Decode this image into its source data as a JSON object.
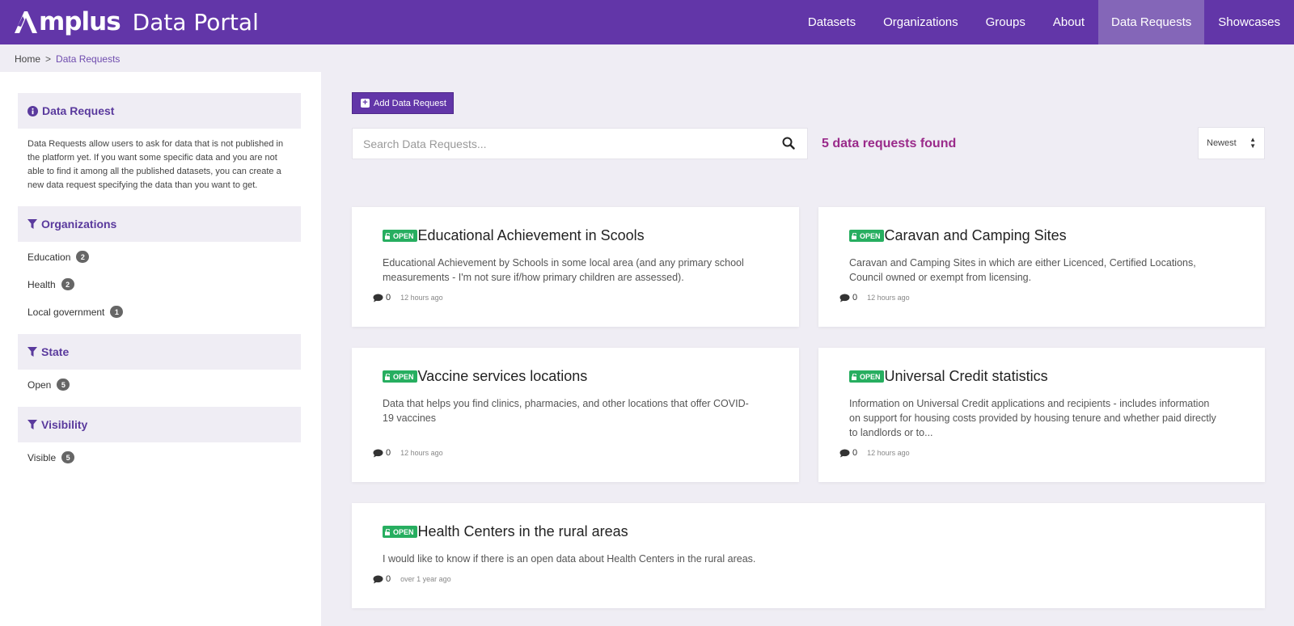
{
  "header": {
    "logo_text": "mplus",
    "portal_label": "Data Portal",
    "nav": [
      {
        "label": "Datasets",
        "active": false
      },
      {
        "label": "Organizations",
        "active": false
      },
      {
        "label": "Groups",
        "active": false
      },
      {
        "label": "About",
        "active": false
      },
      {
        "label": "Data Requests",
        "active": true
      },
      {
        "label": "Showcases",
        "active": false
      }
    ]
  },
  "breadcrumb": {
    "home": "Home",
    "separator": ">",
    "current": "Data Requests"
  },
  "sidebar": {
    "info": {
      "title": "Data Request",
      "description": "Data Requests allow users to ask for data that is not published in the platform yet. If you want some specific data and you are not able to find it among all the published datasets, you can create a new data request specifying the data than you want to get."
    },
    "organizations": {
      "title": "Organizations",
      "items": [
        {
          "label": "Education",
          "count": "2"
        },
        {
          "label": "Health",
          "count": "2"
        },
        {
          "label": "Local government",
          "count": "1"
        }
      ]
    },
    "state": {
      "title": "State",
      "items": [
        {
          "label": "Open",
          "count": "5"
        }
      ]
    },
    "visibility": {
      "title": "Visibility",
      "items": [
        {
          "label": "Visible",
          "count": "5"
        }
      ]
    }
  },
  "main": {
    "add_button": "Add Data Request",
    "search_placeholder": "Search Data Requests...",
    "results_text": "5 data requests found",
    "sort_value": "Newest",
    "badge_label": "OPEN",
    "requests": [
      {
        "title": "Educational Achievement in Scools",
        "description_lines": [
          "Educational Achievement by Schools in some local area (and any primary school",
          "measurements - I'm not sure if/how primary children are assessed)."
        ],
        "comments": "0",
        "time": "12 hours ago"
      },
      {
        "title": "Caravan and Camping Sites",
        "description_lines": [
          "Caravan and Camping Sites in which are either Licenced, Certified Locations,",
          "Council owned or exempt from licensing."
        ],
        "comments": "0",
        "time": "12 hours ago"
      },
      {
        "title": "Vaccine services locations",
        "description_lines": [
          "Data that helps you find clinics, pharmacies, and other locations that offer COVID-",
          "19 vaccines"
        ],
        "comments": "0",
        "time": "12 hours ago"
      },
      {
        "title": "Universal Credit statistics",
        "description_lines": [
          "Information on Universal Credit applications and recipients - includes information",
          "on support for housing costs provided by housing tenure and whether paid directly",
          "to landlords or to..."
        ],
        "comments": "0",
        "time": "12 hours ago"
      },
      {
        "title": "Health Centers in the rural areas",
        "description_lines": [
          "I would like to know if there is an open data about Health Centers in the rural areas."
        ],
        "comments": "0",
        "time": "over 1 year ago"
      }
    ]
  },
  "colors": {
    "brand": "#6236a8",
    "nav_active": "#8466b8",
    "open_badge": "#27ae60",
    "results_text": "#9a2a8a"
  }
}
